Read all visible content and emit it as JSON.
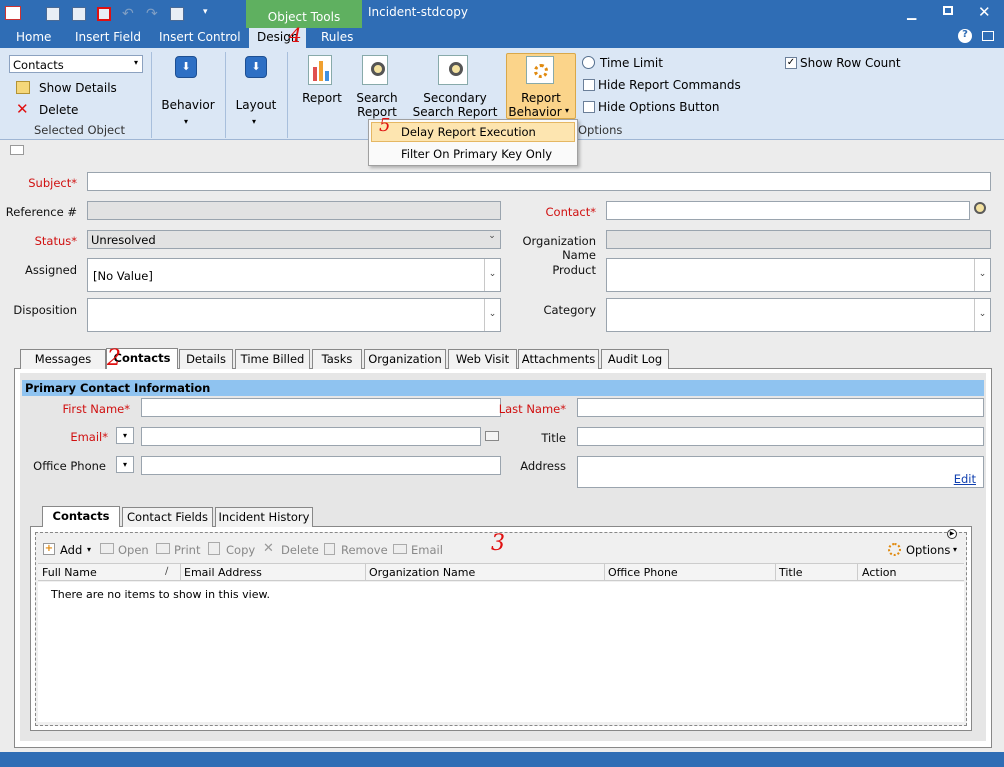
{
  "window": {
    "title": "Incident-stdcopy",
    "context_tab": "Object Tools"
  },
  "ribbon_tabs": [
    "Home",
    "Insert Field",
    "Insert Control",
    "Design",
    "Rules"
  ],
  "ribbon": {
    "object_select": "Contacts",
    "show_details": "Show Details",
    "delete": "Delete",
    "selected_object": "Selected Object",
    "behavior": "Behavior",
    "layout": "Layout",
    "report": "Report",
    "search_report_1": "Search",
    "search_report_2": "Report",
    "secondary_1": "Secondary",
    "secondary_2": "Search Report",
    "report_behavior_1": "Report",
    "report_behavior_2": "Behavior",
    "time_limit": "Time Limit",
    "hide_report_commands": "Hide Report Commands",
    "hide_options_button": "Hide Options Button",
    "show_row_count": "Show Row Count",
    "options_group": "Options"
  },
  "dropdown_menu": [
    "Delay Report Execution",
    "Filter On Primary Key Only"
  ],
  "form": {
    "subject": "Subject",
    "reference": "Reference #",
    "contact": "Contact",
    "status": "Status",
    "status_value": "Unresolved",
    "organization_name": "Organization Name",
    "assigned": "Assigned",
    "assigned_value": "[No Value]",
    "product": "Product",
    "disposition": "Disposition",
    "category": "Category"
  },
  "tabs": [
    "Messages",
    "Contacts",
    "Details",
    "Time Billed",
    "Tasks",
    "Organization",
    "Web Visit",
    "Attachments",
    "Audit Log"
  ],
  "contact_section": {
    "header": "Primary Contact Information",
    "first_name": "First Name",
    "last_name": "Last Name",
    "email": "Email",
    "title": "Title",
    "office_phone": "Office Phone",
    "address": "Address",
    "edit": "Edit"
  },
  "subtabs": [
    "Contacts",
    "Contact Fields",
    "Incident History"
  ],
  "toolbar": {
    "add": "Add",
    "open": "Open",
    "print": "Print",
    "copy": "Copy",
    "delete": "Delete",
    "remove": "Remove",
    "email": "Email",
    "options": "Options"
  },
  "table": {
    "columns": [
      "Full Name",
      "Email Address",
      "Organization Name",
      "Office Phone",
      "Title",
      "Action"
    ],
    "empty": "There are no items to show in this view."
  },
  "annotations": [
    "2",
    "3",
    "4",
    "5"
  ],
  "colors": {
    "title_blue": "#2f6db5",
    "required_red": "#d01010",
    "section_blue": "#8fc3f0"
  }
}
